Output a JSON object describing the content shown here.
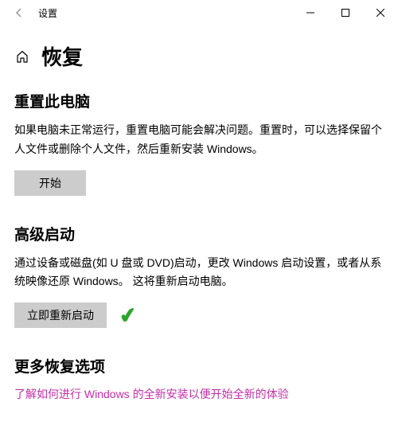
{
  "titlebar": {
    "title": "设置"
  },
  "header": {
    "page_title": "恢复"
  },
  "sections": {
    "reset": {
      "heading": "重置此电脑",
      "body": "如果电脑未正常运行，重置电脑可能会解决问题。重置时，可以选择保留个人文件或删除个人文件，然后重新安装 Windows。",
      "button": "开始"
    },
    "advanced": {
      "heading": "高级启动",
      "body": "通过设备或磁盘(如 U 盘或 DVD)启动，更改 Windows 启动设置，或者从系统映像还原 Windows。 这将重新启动电脑。",
      "button": "立即重新启动"
    },
    "more": {
      "heading": "更多恢复选项",
      "link": "了解如何进行 Windows 的全新安装以便开始全新的体验"
    }
  }
}
